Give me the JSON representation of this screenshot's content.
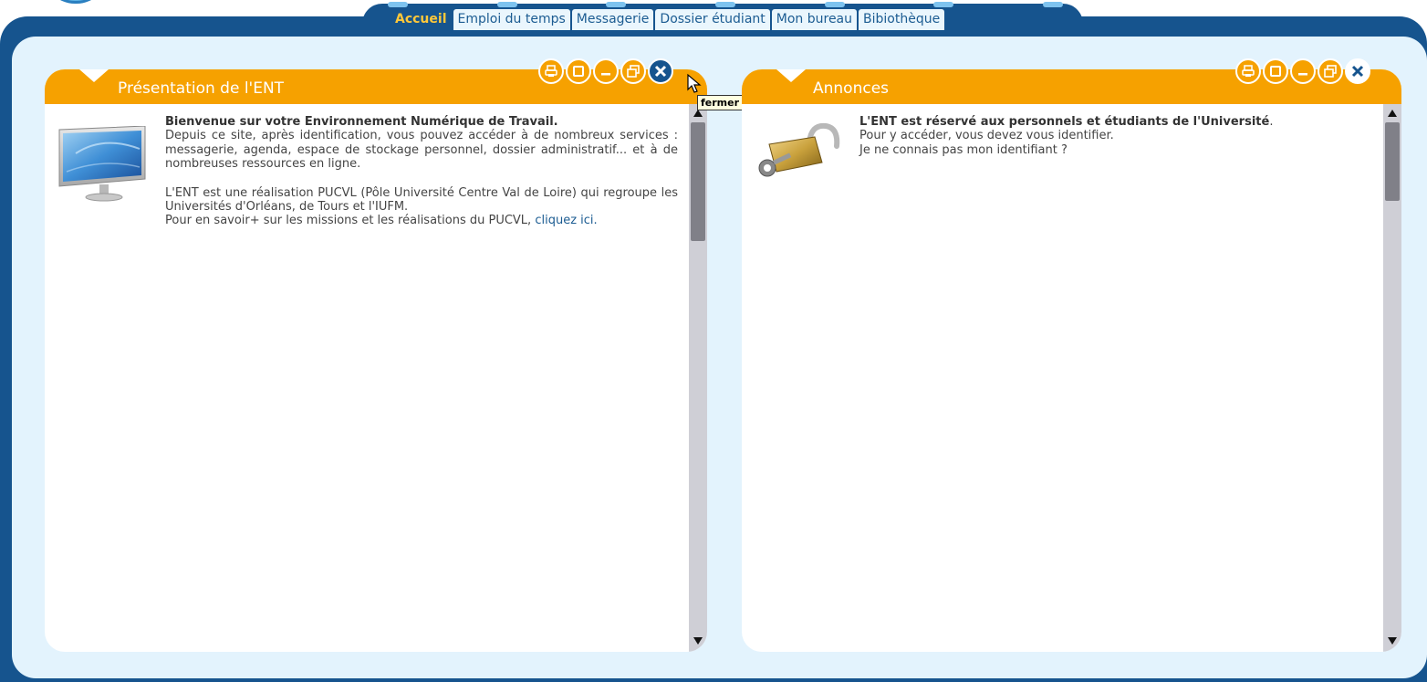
{
  "nav": {
    "tabs": [
      {
        "label": "Accueil",
        "active": true
      },
      {
        "label": "Emploi du temps",
        "active": false
      },
      {
        "label": "Messagerie",
        "active": false
      },
      {
        "label": "Dossier étudiant",
        "active": false
      },
      {
        "label": "Mon bureau",
        "active": false
      },
      {
        "label": "Bibiothèque",
        "active": false
      }
    ]
  },
  "portlets": {
    "left": {
      "title": "Présentation de l'ENT",
      "heading": "Bienvenue sur votre Environnement Numérique de Travail.",
      "para1": "Depuis ce site, après identification, vous pouvez accéder à de nombreux services : messagerie, agenda, espace de stockage personnel, dossier administratif... et à de nombreuses ressources en ligne.",
      "para2": "L'ENT est une réalisation PUCVL (Pôle Université Centre Val de Loire) qui regroupe les Universités d'Orléans, de Tours et l'IUFM.",
      "para3": "Pour en savoir+ sur les missions et les réalisations du PUCVL,",
      "link": "cliquez ici.",
      "image_icon": "monitor-icon",
      "scroll_fraction": 0.22
    },
    "right": {
      "title": "Annonces",
      "heading": "L'ENT est réservé aux personnels et étudiants de l'Université",
      "heading_suffix": ".",
      "line2": "Pour y accéder, vous devez vous identifier.",
      "line3": "Je ne connais pas mon identifiant ?",
      "image_icon": "padlock-icon",
      "scroll_fraction": 0.15
    }
  },
  "controls": [
    "print-icon",
    "maximize-icon",
    "minimize-icon",
    "restore-icon",
    "close-icon"
  ],
  "tooltip": "fermer",
  "colors": {
    "navy": "#16548e",
    "orange": "#f6a100",
    "light_blue": "#e3f3fd",
    "active_tab_text": "#ffc83a"
  }
}
